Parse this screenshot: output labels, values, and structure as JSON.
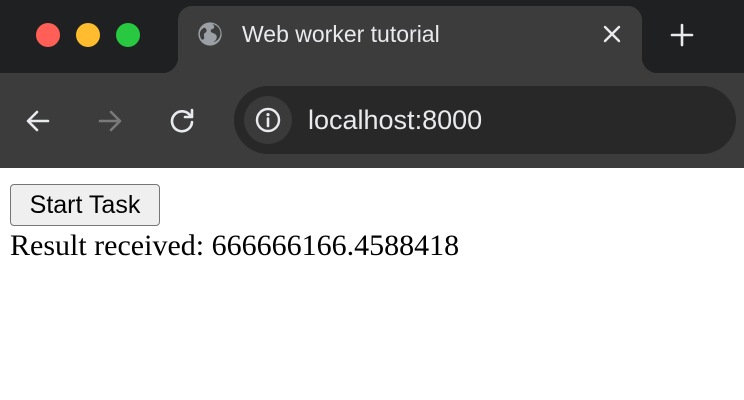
{
  "window": {
    "controls": {
      "close_color": "#ff5f57",
      "minimize_color": "#febc2e",
      "maximize_color": "#28c840"
    }
  },
  "tabs": [
    {
      "title": "Web worker tutorial",
      "favicon": "globe-icon",
      "active": true
    }
  ],
  "toolbar": {
    "back_icon": "arrow-left-icon",
    "forward_icon": "arrow-right-icon",
    "forward_enabled": false,
    "reload_icon": "reload-icon",
    "site_info_icon": "info-icon",
    "url": "localhost:8000"
  },
  "page": {
    "start_button_label": "Start Task",
    "result_text": "Result received: 666666166.4588418"
  },
  "colors": {
    "tabstrip_bg": "#1f2021",
    "toolbar_bg": "#3c3c3c",
    "omnibox_bg": "#282828",
    "chrome_text": "#e8eaed",
    "disabled_icon": "#7a7a7a"
  }
}
